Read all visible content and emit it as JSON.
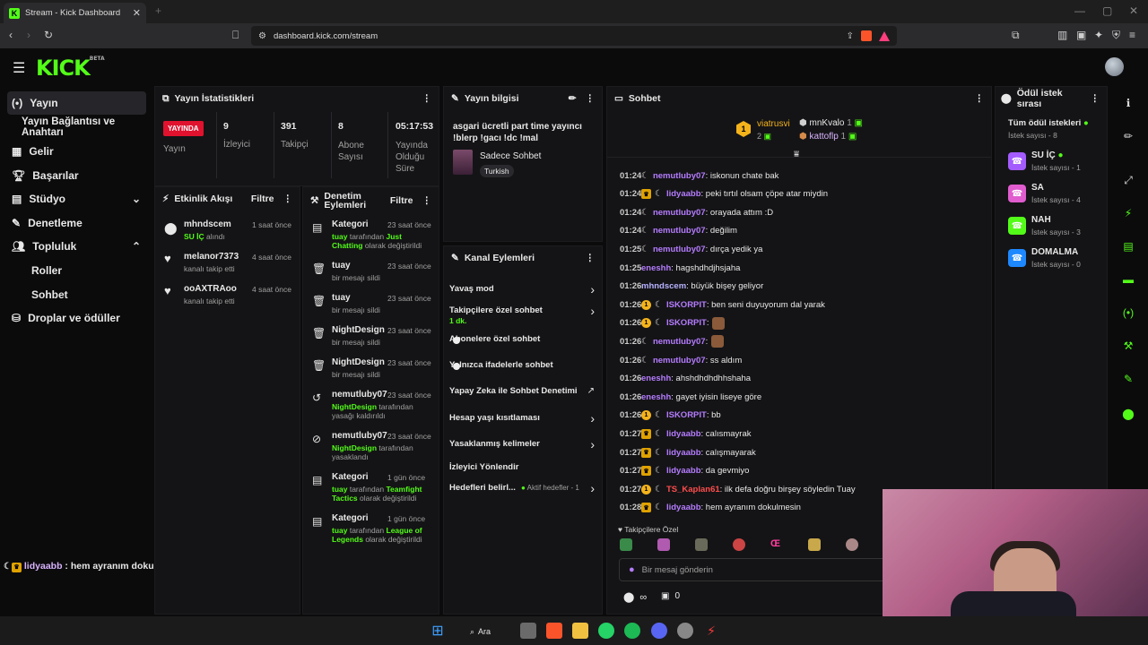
{
  "browser": {
    "tab_title": "Stream - Kick Dashboard",
    "url": "dashboard.kick.com/stream"
  },
  "logo": {
    "text": "KICK",
    "badge": "BETA"
  },
  "sidebar": {
    "items": [
      {
        "label": "Yayın",
        "icon": "broadcast-icon"
      },
      {
        "label": "Yayın Bağlantısı ve Anahtarı"
      },
      {
        "label": "Gelir",
        "icon": "revenue-icon"
      },
      {
        "label": "Başarılar",
        "icon": "trophy-icon"
      },
      {
        "label": "Stüdyo",
        "icon": "studio-icon"
      },
      {
        "label": "Denetleme",
        "icon": "wrench-icon"
      },
      {
        "label": "Topluluk",
        "icon": "community-icon"
      },
      {
        "label": "Roller"
      },
      {
        "label": "Sohbet"
      },
      {
        "label": "Droplar ve ödüller",
        "icon": "drops-icon"
      }
    ]
  },
  "stats": {
    "title": "Yayın İstatistikleri",
    "live_badge": "YAYINDA",
    "live_label": "Yayın",
    "items": [
      {
        "value": "9",
        "label": "İzleyici"
      },
      {
        "value": "391",
        "label": "Takipçi"
      },
      {
        "value": "8",
        "label": "Abone Sayısı"
      },
      {
        "value": "05:17:53",
        "label": "Yayında Olduğu Süre"
      }
    ]
  },
  "activity": {
    "title": "Etkinlik Akışı",
    "filter": "Filtre",
    "items": [
      {
        "user": "mhndscem",
        "time": "1 saat önce",
        "detail_a": "SU İÇ",
        "detail_b": " alındı"
      },
      {
        "user": "melanor7373",
        "time": "4 saat önce",
        "detail_b": "kanalı takip etti"
      },
      {
        "user": "ooAXTRAoo",
        "time": "4 saat önce",
        "detail_b": "kanalı takip etti"
      }
    ]
  },
  "moderation": {
    "title_a": "Denetim",
    "title_b": "Eylemleri",
    "filter": "Filtre",
    "items": [
      {
        "title": "Kategori",
        "time": "23 saat önce",
        "l1a": "tuay",
        "l1b": " tarafından ",
        "l1c": "Just",
        "l2a": "Chatting",
        "l2b": " olarak değiştirildi"
      },
      {
        "title": "tuay",
        "time": "23 saat önce",
        "l1b": "bir mesajı sildi"
      },
      {
        "title": "tuay",
        "time": "23 saat önce",
        "l1b": "bir mesajı sildi"
      },
      {
        "title": "NightDesign",
        "time": "23 saat önce",
        "l1b": "bir mesajı sildi"
      },
      {
        "title": "NightDesign",
        "time": "23 saat önce",
        "l1b": "bir mesajı sildi"
      },
      {
        "title": "nemutluby07",
        "time": "23 saat önce",
        "l1a": "NightDesign",
        "l1b": " tarafından",
        "l2b": "yasağı kaldırıldı"
      },
      {
        "title": "nemutluby07",
        "time": "23 saat önce",
        "l1a": "NightDesign",
        "l1b": " tarafından",
        "l2b": "yasaklandı"
      },
      {
        "title": "Kategori",
        "time": "1 gün önce",
        "l1a": "tuay",
        "l1b": " tarafından ",
        "l1c": "Teamfight",
        "l2a": "Tactics",
        "l2b": " olarak değiştirildi"
      },
      {
        "title": "Kategori",
        "time": "1 gün önce",
        "l1a": "tuay",
        "l1b": " tarafından ",
        "l1c": "League of",
        "l2a": "Legends",
        "l2b": " olarak değiştirildi"
      }
    ]
  },
  "stream_info": {
    "title": "Yayın bilgisi",
    "stream_title": "asgari ücretli part time yayıncı !blerp !gacı !dc !mal",
    "category": "Sadece Sohbet",
    "language": "Turkish"
  },
  "channel_actions": {
    "title": "Kanal Eylemleri",
    "items": [
      {
        "label": "Yavaş mod",
        "kind": "chevron"
      },
      {
        "label": "Takipçilere özel sohbet",
        "sub": "1 dk.",
        "kind": "chevron"
      },
      {
        "label": "Abonelere özel sohbet",
        "kind": "toggle"
      },
      {
        "label": "Yalnızca ifadelerle sohbet",
        "kind": "toggle"
      },
      {
        "label": "Yapay Zeka ile Sohbet Denetimi",
        "kind": "external"
      },
      {
        "label": "Hesap yaşı kısıtlaması",
        "kind": "chevron"
      },
      {
        "label": "Yasaklanmış kelimeler",
        "kind": "chevron"
      },
      {
        "label": "İzleyici Yönlendir",
        "kind": "none"
      },
      {
        "label": "Hedefleri belirl...",
        "sub": "Aktif hedefler - 1",
        "kind": "chevron"
      }
    ]
  },
  "chat": {
    "title": "Sohbet",
    "leaders": [
      {
        "rank": "1",
        "name": "viatrusvi",
        "count": "2"
      },
      {
        "name": "mnKvalo",
        "count": "1"
      },
      {
        "name": "kattoflp",
        "count": "1"
      }
    ],
    "messages": [
      {
        "time": "01:24",
        "badges": [
          "moon"
        ],
        "user": "nemutluby07",
        "color": "#b57cff",
        "text": ": iskonun chate bak"
      },
      {
        "time": "01:24",
        "badges": [
          "crown",
          "moon"
        ],
        "user": "lidyaabb",
        "color": "#b57cff",
        "text": ": peki tırtıl olsam çöpe atar miydin"
      },
      {
        "time": "01:24",
        "badges": [
          "moon"
        ],
        "user": "nemutluby07",
        "color": "#b57cff",
        "text": ": orayada attım :D"
      },
      {
        "time": "01:24",
        "badges": [
          "moon"
        ],
        "user": "nemutluby07",
        "color": "#b57cff",
        "text": ": değilim"
      },
      {
        "time": "01:25",
        "badges": [
          "moon"
        ],
        "user": "nemutluby07",
        "color": "#b57cff",
        "text": ": dırça yedik ya"
      },
      {
        "time": "01:25",
        "badges": [],
        "user": "eneshh",
        "color": "#b57cff",
        "text": ": hagshdhdjhsjaha"
      },
      {
        "time": "01:26",
        "badges": [],
        "user": "mhndscem",
        "color": "#b8b3ff",
        "text": ": büyük bişey geliyor"
      },
      {
        "time": "01:26",
        "badges": [
          "gold",
          "moon"
        ],
        "user": "ISKORPIT",
        "color": "#b57cff",
        "text": ": ben seni duyuyorum dal yarak"
      },
      {
        "time": "01:26",
        "badges": [
          "gold",
          "moon"
        ],
        "user": "ISKORPIT",
        "color": "#b57cff",
        "text": ":",
        "emote": true
      },
      {
        "time": "01:26",
        "badges": [
          "moon"
        ],
        "user": "nemutluby07",
        "color": "#b57cff",
        "text": ":",
        "emote": true
      },
      {
        "time": "01:26",
        "badges": [
          "moon"
        ],
        "user": "nemutluby07",
        "color": "#b57cff",
        "text": ": ss aldım"
      },
      {
        "time": "01:26",
        "badges": [],
        "user": "eneshh",
        "color": "#b57cff",
        "text": ": ahshdhdhdhhshaha"
      },
      {
        "time": "01:26",
        "badges": [],
        "user": "eneshh",
        "color": "#b57cff",
        "text": ": gayet iyisin liseye göre"
      },
      {
        "time": "01:26",
        "badges": [
          "gold",
          "moon"
        ],
        "user": "ISKORPIT",
        "color": "#b57cff",
        "text": ": bb"
      },
      {
        "time": "01:27",
        "badges": [
          "crown",
          "moon"
        ],
        "user": "lidyaabb",
        "color": "#b57cff",
        "text": ": calısmayrak"
      },
      {
        "time": "01:27",
        "badges": [
          "crown",
          "moon"
        ],
        "user": "lidyaabb",
        "color": "#b57cff",
        "text": ": calışmayarak"
      },
      {
        "time": "01:27",
        "badges": [
          "crown",
          "moon"
        ],
        "user": "lidyaabb",
        "color": "#b57cff",
        "text": ": da gevmiyo"
      },
      {
        "time": "01:27",
        "badges": [
          "gold",
          "moon"
        ],
        "user": "TS_Kaplan61",
        "color": "#ff4d4d",
        "text": ": ilk defa doğru birşey söyledin Tuay"
      },
      {
        "time": "01:28",
        "badges": [
          "crown",
          "moon"
        ],
        "user": "lidyaabb",
        "color": "#b57cff",
        "text": ": hem ayranım dokulmesin"
      }
    ],
    "follower_emotes_label": "Takipçilere Özel",
    "input_placeholder": "Bir mesaj gönderin",
    "footer_infinity": "∞",
    "footer_count": "0"
  },
  "rewards": {
    "title": "Ödül istek sırası",
    "all_label": "Tüm ödül istekleri",
    "all_count": "İstek sayısı - 8",
    "items": [
      {
        "name": "SU İÇ",
        "count": "İstek sayısı - 1",
        "color": "#a45cff"
      },
      {
        "name": "SA",
        "count": "İstek sayısı - 4",
        "color": "#e05ccf"
      },
      {
        "name": "NAH",
        "count": "İstek sayısı - 3",
        "color": "#53fc18"
      },
      {
        "name": "DOMALMA",
        "count": "İstek sayısı - 0",
        "color": "#1e88ff"
      }
    ]
  },
  "overlay": {
    "user": "lidyaabb",
    "text": " : hem ayranım dokulmesin"
  },
  "taskbar": {
    "search": "Ara"
  }
}
